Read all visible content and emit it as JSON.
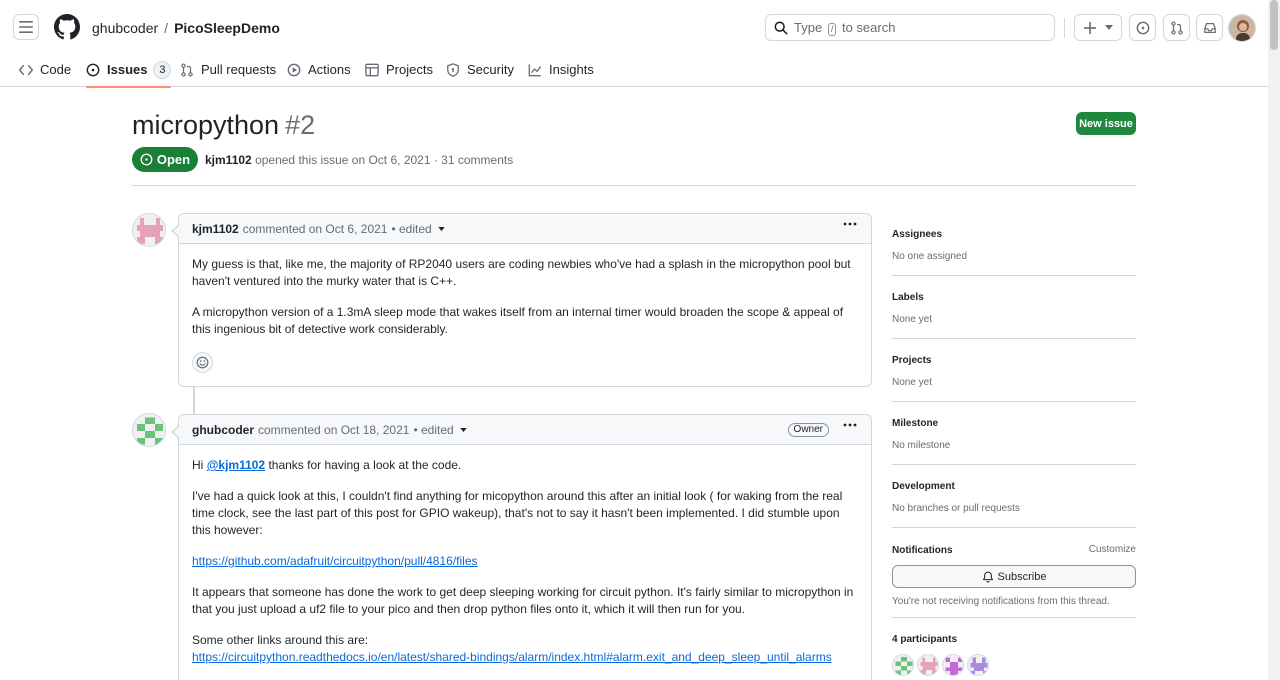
{
  "header": {
    "owner": "ghubcoder",
    "separator": "/",
    "repo": "PicoSleepDemo",
    "search_prefix": "Type",
    "search_key": "/",
    "search_suffix": "to search"
  },
  "nav": {
    "tabs": [
      {
        "label": "Code",
        "icon": "code-icon"
      },
      {
        "label": "Issues",
        "icon": "issue-opened-icon",
        "count": "3",
        "active": true
      },
      {
        "label": "Pull requests",
        "icon": "git-pull-request-icon"
      },
      {
        "label": "Actions",
        "icon": "play-icon"
      },
      {
        "label": "Projects",
        "icon": "table-icon"
      },
      {
        "label": "Security",
        "icon": "shield-icon"
      },
      {
        "label": "Insights",
        "icon": "graph-icon"
      }
    ]
  },
  "issue": {
    "title": "micropython",
    "number": "#2",
    "new_issue_label": "New issue",
    "state": "Open",
    "author": "kjm1102",
    "meta_text": "opened this issue on Oct 6, 2021 · 31 comments"
  },
  "comments": [
    {
      "author": "kjm1102",
      "action": "commented on Oct 6, 2021",
      "edited": "• edited",
      "paragraphs": [
        "My guess is that, like me, the majority of RP2040 users are coding newbies who've had a splash in the micropython pool but haven't ventured into the murky water that is C++.",
        "A micropython version of a 1.3mA sleep mode that wakes itself from an internal timer would broaden the scope & appeal of this ingenious bit of detective work considerably."
      ]
    },
    {
      "author": "ghubcoder",
      "action": "commented on Oct 18, 2021",
      "edited": "• edited",
      "badge": "Owner",
      "greeting_prefix": "Hi",
      "mention": "@kjm1102",
      "greeting_suffix": "thanks for having a look at the code.",
      "p2": "I've had a quick look at this, I couldn't find anything for micopython around this after an initial look ( for waking from the real time clock, see the last part of this post for GPIO wakeup), that's not to say it hasn't been implemented. I did stumble upon this however:",
      "link1": "https://github.com/adafruit/circuitpython/pull/4816/files",
      "p3": "It appears that someone has done the work to get deep sleeping working for circuit python. It's fairly similar to micropython in that you just upload a uf2 file to your pico and then drop python files onto it, which it will then run for you.",
      "p4": "Some other links around this are:",
      "link2": "https://circuitpython.readthedocs.io/en/latest/shared-bindings/alarm/index.html#alarm.exit_and_deep_sleep_until_alarms"
    }
  ],
  "sidebar": {
    "assignees": {
      "title": "Assignees",
      "value": "No one assigned"
    },
    "labels": {
      "title": "Labels",
      "value": "None yet"
    },
    "projects": {
      "title": "Projects",
      "value": "None yet"
    },
    "milestone": {
      "title": "Milestone",
      "value": "No milestone"
    },
    "development": {
      "title": "Development",
      "value": "No branches or pull requests"
    },
    "notifications": {
      "title": "Notifications",
      "customize": "Customize",
      "subscribe": "Subscribe",
      "note": "You're not receiving notifications from this thread."
    },
    "participants": {
      "title": "4 participants"
    }
  },
  "colors": {
    "accent_green": "#1f883d",
    "link_blue": "#0969da",
    "tab_underline": "#fd8c73"
  }
}
